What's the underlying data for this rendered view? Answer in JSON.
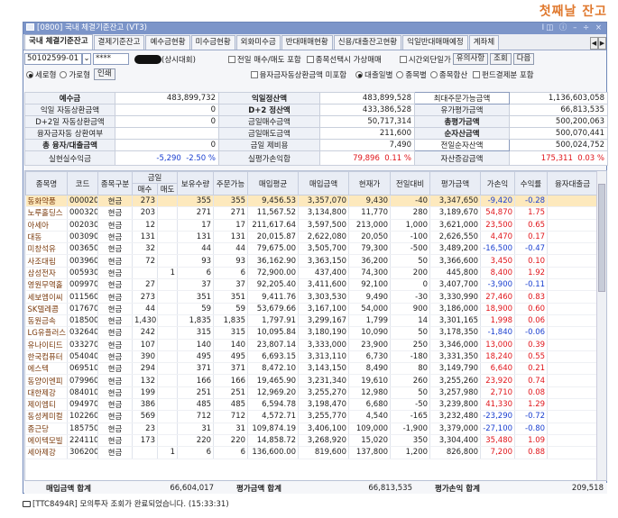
{
  "banner": "첫째날 잔고",
  "window": {
    "title": "[0800] 국내 체결기준잔고 (VT3)",
    "controls": "Ⅰ◫ ⓘ – ÷ ×"
  },
  "tabs": [
    "국내 체결기준잔고",
    "결제기준잔고",
    "예수금현황",
    "미수금현황",
    "외화미수금",
    "반대매매현황",
    "신용/대출잔고현황",
    "익일반대매매예정",
    "계좌체"
  ],
  "account": {
    "number": "50102599-01",
    "password": "****",
    "name": "(상시대회)"
  },
  "options": {
    "prev_day": "전일 매수/매도 포함",
    "pick_stock": "종목선택시 가상매매",
    "time_order": "시간외단일가",
    "notice": "유의사항",
    "query": "조회",
    "next": "다음",
    "sort_new": "세로형",
    "sort_wide": "가로형",
    "print": "인쇄",
    "credit_auto": "융자금자동상환금액 미포함",
    "loan_daily": "대출일별",
    "by_stock": "종목별",
    "stock_sum": "종목합산",
    "fund_exclude": "펀드결제분 포함"
  },
  "summary": {
    "deposit_label": "예수금",
    "deposit": "483,899,732",
    "next_settle_label": "익일정산액",
    "next_settle": "483,899,528",
    "max_order_label": "최대주문가능금액",
    "max_order": "1,136,603,058",
    "auto_repay_label": "익일 자동상환금액",
    "auto_repay": "0",
    "d2_label": "D+2 정산액",
    "d2": "433,386,528",
    "eval_label": "유가평가금액",
    "eval": "66,813,535",
    "d2_auto_label": "D+2일 자동상환금액",
    "d2_auto": "0",
    "buy_today_label": "금일매수금액",
    "buy_today": "50,717,314",
    "total_eval_label": "총평가금액",
    "total_eval": "500,200,063",
    "credit_repay_label": "융자금자동 상환여부",
    "credit_repay": "",
    "sell_today_label": "금일매도금액",
    "sell_today": "211,600",
    "net_asset_label": "순자산금액",
    "net_asset": "500,070,441",
    "total_loan_label": "총 융자/대출금액",
    "total_loan": "0",
    "fee_today_label": "금일 제비용",
    "fee_today": "7,490",
    "prev_asset_label": "전일순자산액",
    "prev_asset": "500,024,752",
    "realized_label": "실현실수익금",
    "realized": "-5,290",
    "realized_rate": "-2.50 %",
    "unrealized_label": "실평가손익합",
    "unrealized": "79,896",
    "unrealized_rate": "0.11 %",
    "asset_change_label": "자산증감금액",
    "asset_change": "175,311",
    "asset_change_rate": "0.03 %"
  },
  "grid_headers": [
    "종목명",
    "코드",
    "종목구분",
    "금일",
    "",
    "보유수량",
    "주문가능",
    "매입평균",
    "매입금액",
    "현재가",
    "전일대비",
    "평가금액",
    "가손익",
    "수익률",
    "융자대출금"
  ],
  "grid_subheaders": [
    "매수",
    "매도"
  ],
  "rows": [
    {
      "name": "동화약품",
      "code": "000020",
      "type": "현금",
      "buy": "273",
      "sell": "",
      "qty": "355",
      "avail": "355",
      "avg": "9,456.53",
      "buyamt": "3,357,070",
      "price": "9,430",
      "diff": "-40",
      "eval": "3,347,650",
      "pl": "-9,420",
      "rate": "-0.28",
      "loan": ""
    },
    {
      "name": "노루홀딩스",
      "code": "000320",
      "type": "현금",
      "buy": "203",
      "sell": "",
      "qty": "271",
      "avail": "271",
      "avg": "11,567.52",
      "buyamt": "3,134,800",
      "price": "11,770",
      "diff": "280",
      "eval": "3,189,670",
      "pl": "54,870",
      "rate": "1.75",
      "loan": ""
    },
    {
      "name": "아세아",
      "code": "002030",
      "type": "현금",
      "buy": "12",
      "sell": "",
      "qty": "17",
      "avail": "17",
      "avg": "211,617.64",
      "buyamt": "3,597,500",
      "price": "213,000",
      "diff": "1,000",
      "eval": "3,621,000",
      "pl": "23,500",
      "rate": "0.65",
      "loan": ""
    },
    {
      "name": "대동",
      "code": "003090",
      "type": "현금",
      "buy": "131",
      "sell": "",
      "qty": "131",
      "avail": "131",
      "avg": "20,015.87",
      "buyamt": "2,622,080",
      "price": "20,050",
      "diff": "-100",
      "eval": "2,626,550",
      "pl": "4,470",
      "rate": "0.17",
      "loan": ""
    },
    {
      "name": "미창석유",
      "code": "003650",
      "type": "현금",
      "buy": "32",
      "sell": "",
      "qty": "44",
      "avail": "44",
      "avg": "79,675.00",
      "buyamt": "3,505,700",
      "price": "79,300",
      "diff": "-500",
      "eval": "3,489,200",
      "pl": "-16,500",
      "rate": "-0.47",
      "loan": ""
    },
    {
      "name": "사조대림",
      "code": "003960",
      "type": "현금",
      "buy": "72",
      "sell": "",
      "qty": "93",
      "avail": "93",
      "avg": "36,162.90",
      "buyamt": "3,363,150",
      "price": "36,200",
      "diff": "50",
      "eval": "3,366,600",
      "pl": "3,450",
      "rate": "0.10",
      "loan": ""
    },
    {
      "name": "삼성전자",
      "code": "005930",
      "type": "현금",
      "buy": "",
      "sell": "1",
      "qty": "6",
      "avail": "6",
      "avg": "72,900.00",
      "buyamt": "437,400",
      "price": "74,300",
      "diff": "200",
      "eval": "445,800",
      "pl": "8,400",
      "rate": "1.92",
      "loan": ""
    },
    {
      "name": "영원무역홀",
      "code": "009970",
      "type": "현금",
      "buy": "27",
      "sell": "",
      "qty": "37",
      "avail": "37",
      "avg": "92,205.40",
      "buyamt": "3,411,600",
      "price": "92,100",
      "diff": "0",
      "eval": "3,407,700",
      "pl": "-3,900",
      "rate": "-0.11",
      "loan": ""
    },
    {
      "name": "세보엠이씨",
      "code": "011560",
      "type": "현금",
      "buy": "273",
      "sell": "",
      "qty": "351",
      "avail": "351",
      "avg": "9,411.76",
      "buyamt": "3,303,530",
      "price": "9,490",
      "diff": "-30",
      "eval": "3,330,990",
      "pl": "27,460",
      "rate": "0.83",
      "loan": ""
    },
    {
      "name": "SK텔레콤",
      "code": "017670",
      "type": "현금",
      "buy": "44",
      "sell": "",
      "qty": "59",
      "avail": "59",
      "avg": "53,679.66",
      "buyamt": "3,167,100",
      "price": "54,000",
      "diff": "900",
      "eval": "3,186,000",
      "pl": "18,900",
      "rate": "0.60",
      "loan": ""
    },
    {
      "name": "동원금속",
      "code": "018500",
      "type": "현금",
      "buy": "1,430",
      "sell": "",
      "qty": "1,835",
      "avail": "1,835",
      "avg": "1,797.91",
      "buyamt": "3,299,167",
      "price": "1,799",
      "diff": "14",
      "eval": "3,301,165",
      "pl": "1,998",
      "rate": "0.06",
      "loan": ""
    },
    {
      "name": "LG유플러스",
      "code": "032640",
      "type": "현금",
      "buy": "242",
      "sell": "",
      "qty": "315",
      "avail": "315",
      "avg": "10,095.84",
      "buyamt": "3,180,190",
      "price": "10,090",
      "diff": "50",
      "eval": "3,178,350",
      "pl": "-1,840",
      "rate": "-0.06",
      "loan": ""
    },
    {
      "name": "유나이티드",
      "code": "033270",
      "type": "현금",
      "buy": "107",
      "sell": "",
      "qty": "140",
      "avail": "140",
      "avg": "23,807.14",
      "buyamt": "3,333,000",
      "price": "23,900",
      "diff": "250",
      "eval": "3,346,000",
      "pl": "13,000",
      "rate": "0.39",
      "loan": ""
    },
    {
      "name": "한국컴퓨터",
      "code": "054040",
      "type": "현금",
      "buy": "390",
      "sell": "",
      "qty": "495",
      "avail": "495",
      "avg": "6,693.15",
      "buyamt": "3,313,110",
      "price": "6,730",
      "diff": "-180",
      "eval": "3,331,350",
      "pl": "18,240",
      "rate": "0.55",
      "loan": ""
    },
    {
      "name": "에스텍",
      "code": "069510",
      "type": "현금",
      "buy": "294",
      "sell": "",
      "qty": "371",
      "avail": "371",
      "avg": "8,472.10",
      "buyamt": "3,143,150",
      "price": "8,490",
      "diff": "80",
      "eval": "3,149,790",
      "pl": "6,640",
      "rate": "0.21",
      "loan": ""
    },
    {
      "name": "동양이엔피",
      "code": "079960",
      "type": "현금",
      "buy": "132",
      "sell": "",
      "qty": "166",
      "avail": "166",
      "avg": "19,465.90",
      "buyamt": "3,231,340",
      "price": "19,610",
      "diff": "260",
      "eval": "3,255,260",
      "pl": "23,920",
      "rate": "0.74",
      "loan": ""
    },
    {
      "name": "대한제강",
      "code": "084010",
      "type": "현금",
      "buy": "199",
      "sell": "",
      "qty": "251",
      "avail": "251",
      "avg": "12,969.20",
      "buyamt": "3,255,270",
      "price": "12,980",
      "diff": "50",
      "eval": "3,257,980",
      "pl": "2,710",
      "rate": "0.08",
      "loan": ""
    },
    {
      "name": "제이엠티",
      "code": "094970",
      "type": "현금",
      "buy": "386",
      "sell": "",
      "qty": "485",
      "avail": "485",
      "avg": "6,594.78",
      "buyamt": "3,198,470",
      "price": "6,680",
      "diff": "-50",
      "eval": "3,239,800",
      "pl": "41,330",
      "rate": "1.29",
      "loan": ""
    },
    {
      "name": "동성케미컬",
      "code": "102260",
      "type": "현금",
      "buy": "569",
      "sell": "",
      "qty": "712",
      "avail": "712",
      "avg": "4,572.71",
      "buyamt": "3,255,770",
      "price": "4,540",
      "diff": "-165",
      "eval": "3,232,480",
      "pl": "-23,290",
      "rate": "-0.72",
      "loan": ""
    },
    {
      "name": "종근당",
      "code": "185750",
      "type": "현금",
      "buy": "23",
      "sell": "",
      "qty": "31",
      "avail": "31",
      "avg": "109,874.19",
      "buyamt": "3,406,100",
      "price": "109,000",
      "diff": "-1,900",
      "eval": "3,379,000",
      "pl": "-27,100",
      "rate": "-0.80",
      "loan": ""
    },
    {
      "name": "에이텍모빌",
      "code": "224110",
      "type": "현금",
      "buy": "173",
      "sell": "",
      "qty": "220",
      "avail": "220",
      "avg": "14,858.72",
      "buyamt": "3,268,920",
      "price": "15,020",
      "diff": "350",
      "eval": "3,304,400",
      "pl": "35,480",
      "rate": "1.09",
      "loan": ""
    },
    {
      "name": "세아제강",
      "code": "306200",
      "type": "현금",
      "buy": "",
      "sell": "1",
      "qty": "6",
      "avail": "6",
      "avg": "136,600.00",
      "buyamt": "819,600",
      "price": "137,800",
      "diff": "1,200",
      "eval": "826,800",
      "pl": "7,200",
      "rate": "0.88",
      "loan": ""
    }
  ],
  "totals": {
    "buy_total_label": "매입금액 합계",
    "buy_total": "66,604,017",
    "eval_total_label": "평가금액 합계",
    "eval_total": "66,813,535",
    "pl_total_label": "평가손익 합계",
    "pl_total": "209,518"
  },
  "status": "[TTC8494R] 모의투자 조회가 완료되었습니다. (15:33:31)"
}
